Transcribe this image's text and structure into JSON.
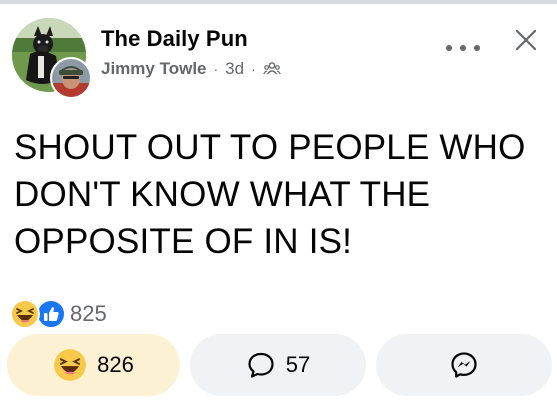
{
  "post": {
    "page_name": "The Daily Pun",
    "author": "Jimmy Towle",
    "time": "3d",
    "separator": "·",
    "audience_icon": "friends-icon",
    "text": "SHOUT OUT TO PEOPLE WHO DON'T KNOW WHAT THE OPPOSITE OF IN IS!"
  },
  "header_icons": {
    "more": "more-options-icon",
    "close": "close-icon"
  },
  "reactions": {
    "icons": [
      "haha-reaction-icon",
      "like-reaction-icon"
    ],
    "count": "825"
  },
  "actions": {
    "reaction_count": "826",
    "comment_count": "57",
    "share_icon": "messenger-icon"
  },
  "colors": {
    "like_button_bg": "#fdf1d3",
    "button_bg": "#f0f2f5",
    "like_blue": "#1877f2",
    "haha_yellow": "#f7c94b",
    "secondary_text": "#65676b"
  }
}
